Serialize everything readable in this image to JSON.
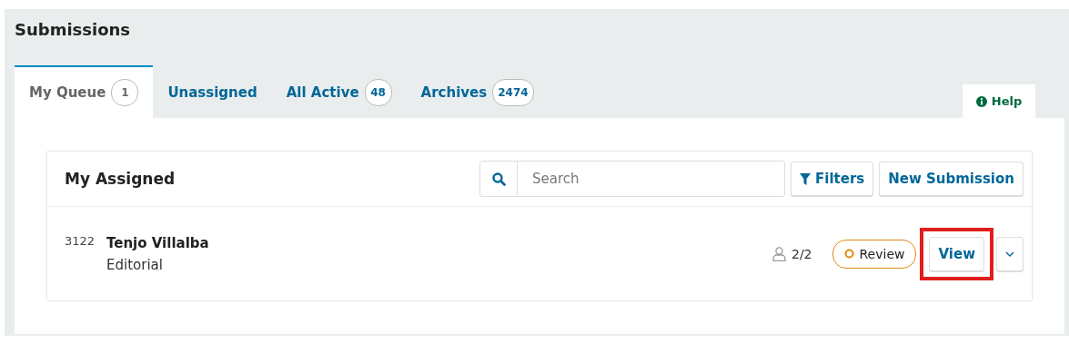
{
  "page_title": "Submissions",
  "tabs": [
    {
      "label": "My Queue",
      "count": "1",
      "selected": true
    },
    {
      "label": "Unassigned",
      "selected": false
    },
    {
      "label": "All Active",
      "count": "48",
      "selected": false
    },
    {
      "label": "Archives",
      "count": "2474",
      "selected": false
    }
  ],
  "help": {
    "label": "Help"
  },
  "list": {
    "title": "My Assigned",
    "search": {
      "placeholder": "Search"
    },
    "filters_button": "Filters",
    "new_button": "New Submission",
    "rows": [
      {
        "id": "3122",
        "author": "Tenjo Villalba",
        "section": "Editorial",
        "participants": "2/2",
        "stage": {
          "label": "Review",
          "color": "#e08914"
        },
        "view_button": "View",
        "view_highlighted": true
      }
    ]
  }
}
